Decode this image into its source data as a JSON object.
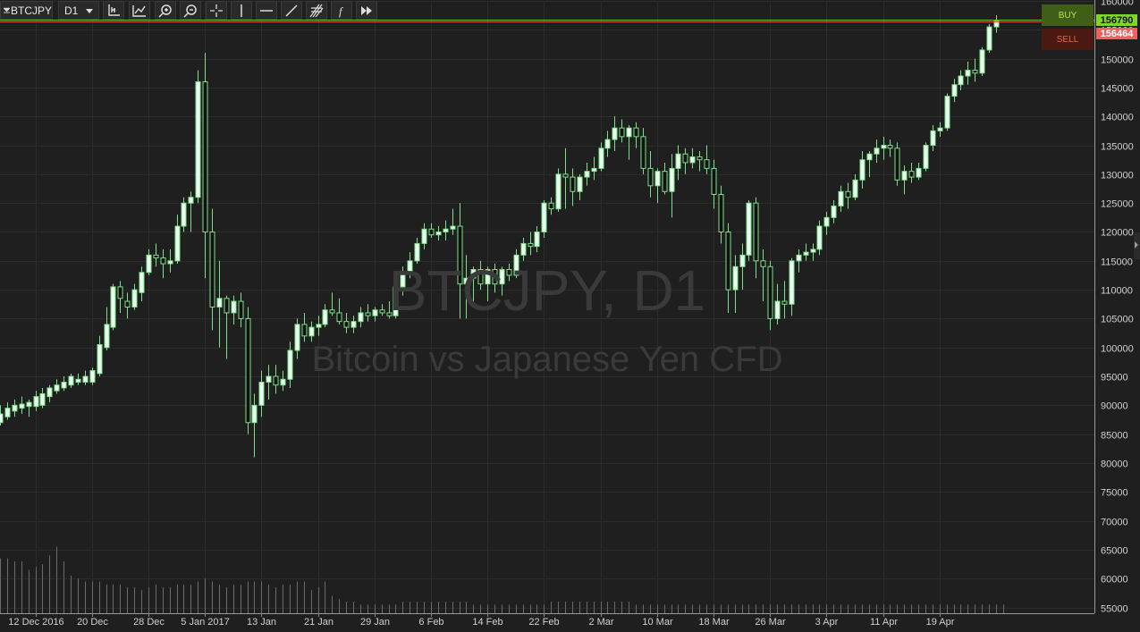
{
  "toolbar": {
    "symbol": "BTCJPY",
    "timeframe": "D1",
    "tools": [
      "crosshair-cursor-icon",
      "auto-scale-icon",
      "zoom-in-icon",
      "zoom-out-icon",
      "crosshair-icon",
      "vertical-line-icon",
      "horizontal-line-icon",
      "trend-line-icon",
      "fibonacci-icon",
      "indicators-icon",
      "fast-forward-icon"
    ]
  },
  "watermark": {
    "title": "BTCJPY, D1",
    "subtitle": "Bitcoin vs Japanese Yen CFD"
  },
  "trade": {
    "buy_label": "BUY",
    "sell_label": "SELL",
    "ask": "156790",
    "bid": "156464"
  },
  "colors": {
    "background": "#1f1f1f",
    "grid": "#2c2c2c",
    "bull_fill": "#e8fff0",
    "candle_outline": "#7ee08a",
    "bear_fill": "#111111",
    "volume": "#6a6a6a",
    "ask_line": "#6ec42a",
    "bid_line": "#e05a4a"
  },
  "chart_data": {
    "type": "candlestick",
    "ylim": [
      54000,
      160000
    ],
    "yticks": [
      55000,
      60000,
      65000,
      70000,
      75000,
      80000,
      85000,
      90000,
      95000,
      100000,
      105000,
      110000,
      115000,
      120000,
      125000,
      130000,
      135000,
      140000,
      145000,
      150000,
      155000,
      160000
    ],
    "xtick_labels": [
      "12 Dec 2016",
      "20 Dec",
      "28 Dec",
      "5 Jan 2017",
      "13 Jan",
      "21 Jan",
      "29 Jan",
      "6 Feb",
      "14 Feb",
      "22 Feb",
      "2 Mar",
      "10 Mar",
      "18 Mar",
      "26 Mar",
      "3 Apr",
      "11 Apr",
      "19 Apr"
    ],
    "xtick_index": [
      5,
      13,
      21,
      29,
      37,
      45,
      53,
      61,
      69,
      77,
      85,
      93,
      101,
      109,
      117,
      125,
      133
    ],
    "grid": true,
    "series": [
      {
        "o": 87000,
        "h": 90000,
        "l": 86500,
        "c": 88500
      },
      {
        "o": 88000,
        "h": 90500,
        "l": 87500,
        "c": 89500
      },
      {
        "o": 89000,
        "h": 91000,
        "l": 88000,
        "c": 90000
      },
      {
        "o": 89500,
        "h": 91500,
        "l": 88500,
        "c": 90200
      },
      {
        "o": 89800,
        "h": 91000,
        "l": 88000,
        "c": 90500
      },
      {
        "o": 89800,
        "h": 92500,
        "l": 89000,
        "c": 91500
      },
      {
        "o": 90000,
        "h": 93000,
        "l": 89500,
        "c": 92000
      },
      {
        "o": 91500,
        "h": 93500,
        "l": 90500,
        "c": 93000
      },
      {
        "o": 92500,
        "h": 94500,
        "l": 92000,
        "c": 93500
      },
      {
        "o": 93000,
        "h": 95000,
        "l": 92500,
        "c": 94000
      },
      {
        "o": 93500,
        "h": 95500,
        "l": 93000,
        "c": 95000
      },
      {
        "o": 94000,
        "h": 95500,
        "l": 93500,
        "c": 94500
      },
      {
        "o": 94000,
        "h": 96000,
        "l": 93500,
        "c": 95000
      },
      {
        "o": 94000,
        "h": 96500,
        "l": 93500,
        "c": 96000
      },
      {
        "o": 95500,
        "h": 102000,
        "l": 95000,
        "c": 100500
      },
      {
        "o": 100000,
        "h": 107000,
        "l": 99500,
        "c": 104000
      },
      {
        "o": 103500,
        "h": 111000,
        "l": 103000,
        "c": 110500
      },
      {
        "o": 110500,
        "h": 111500,
        "l": 106000,
        "c": 108500
      },
      {
        "o": 108000,
        "h": 109500,
        "l": 105000,
        "c": 107000
      },
      {
        "o": 107000,
        "h": 111000,
        "l": 106500,
        "c": 110000
      },
      {
        "o": 109500,
        "h": 114000,
        "l": 108000,
        "c": 113000
      },
      {
        "o": 113000,
        "h": 117000,
        "l": 112500,
        "c": 116000
      },
      {
        "o": 116000,
        "h": 118000,
        "l": 114000,
        "c": 115500
      },
      {
        "o": 115500,
        "h": 117000,
        "l": 112000,
        "c": 114500
      },
      {
        "o": 114500,
        "h": 117000,
        "l": 113000,
        "c": 115000
      },
      {
        "o": 115000,
        "h": 123000,
        "l": 114500,
        "c": 121000
      },
      {
        "o": 121000,
        "h": 126000,
        "l": 120000,
        "c": 125000
      },
      {
        "o": 125000,
        "h": 127000,
        "l": 120000,
        "c": 126000
      },
      {
        "o": 126000,
        "h": 148000,
        "l": 125000,
        "c": 146000
      },
      {
        "o": 146000,
        "h": 151000,
        "l": 112000,
        "c": 120000
      },
      {
        "o": 120000,
        "h": 124000,
        "l": 103000,
        "c": 107000
      },
      {
        "o": 107000,
        "h": 115000,
        "l": 100000,
        "c": 108500
      },
      {
        "o": 108500,
        "h": 109000,
        "l": 98000,
        "c": 106000
      },
      {
        "o": 106000,
        "h": 109000,
        "l": 104000,
        "c": 108000
      },
      {
        "o": 108000,
        "h": 109500,
        "l": 103500,
        "c": 105000
      },
      {
        "o": 105000,
        "h": 107000,
        "l": 85000,
        "c": 87000
      },
      {
        "o": 87000,
        "h": 92000,
        "l": 81000,
        "c": 90000
      },
      {
        "o": 90000,
        "h": 96000,
        "l": 88000,
        "c": 94000
      },
      {
        "o": 94000,
        "h": 97000,
        "l": 91000,
        "c": 95000
      },
      {
        "o": 95000,
        "h": 97000,
        "l": 92000,
        "c": 93500
      },
      {
        "o": 93500,
        "h": 96000,
        "l": 92500,
        "c": 94500
      },
      {
        "o": 94500,
        "h": 101000,
        "l": 93000,
        "c": 99500
      },
      {
        "o": 99500,
        "h": 105000,
        "l": 98000,
        "c": 104000
      },
      {
        "o": 104000,
        "h": 106000,
        "l": 101000,
        "c": 102000
      },
      {
        "o": 102000,
        "h": 104500,
        "l": 101000,
        "c": 103500
      },
      {
        "o": 103500,
        "h": 105500,
        "l": 102000,
        "c": 104000
      },
      {
        "o": 104000,
        "h": 107500,
        "l": 103500,
        "c": 106500
      },
      {
        "o": 106500,
        "h": 109500,
        "l": 105500,
        "c": 106000
      },
      {
        "o": 106000,
        "h": 108500,
        "l": 104000,
        "c": 104500
      },
      {
        "o": 104500,
        "h": 106000,
        "l": 102500,
        "c": 103500
      },
      {
        "o": 103500,
        "h": 105500,
        "l": 102500,
        "c": 104500
      },
      {
        "o": 104500,
        "h": 107000,
        "l": 103500,
        "c": 106000
      },
      {
        "o": 106000,
        "h": 107500,
        "l": 104500,
        "c": 105500
      },
      {
        "o": 105500,
        "h": 107000,
        "l": 104500,
        "c": 106500
      },
      {
        "o": 106500,
        "h": 107500,
        "l": 105500,
        "c": 106000
      },
      {
        "o": 106000,
        "h": 108000,
        "l": 105000,
        "c": 105500
      },
      {
        "o": 105500,
        "h": 111000,
        "l": 105000,
        "c": 110500
      },
      {
        "o": 110500,
        "h": 114000,
        "l": 109000,
        "c": 113000
      },
      {
        "o": 113000,
        "h": 116500,
        "l": 112000,
        "c": 115000
      },
      {
        "o": 115000,
        "h": 119000,
        "l": 114500,
        "c": 118000
      },
      {
        "o": 118000,
        "h": 121500,
        "l": 117000,
        "c": 120500
      },
      {
        "o": 120500,
        "h": 121500,
        "l": 119000,
        "c": 119500
      },
      {
        "o": 119500,
        "h": 121000,
        "l": 118500,
        "c": 120000
      },
      {
        "o": 120000,
        "h": 122000,
        "l": 118500,
        "c": 120500
      },
      {
        "o": 120500,
        "h": 124000,
        "l": 119500,
        "c": 121000
      },
      {
        "o": 121000,
        "h": 125000,
        "l": 105000,
        "c": 111000
      },
      {
        "o": 111000,
        "h": 116000,
        "l": 105000,
        "c": 112000
      },
      {
        "o": 112000,
        "h": 114000,
        "l": 108000,
        "c": 113500
      },
      {
        "o": 113500,
        "h": 115000,
        "l": 110000,
        "c": 111000
      },
      {
        "o": 111000,
        "h": 114000,
        "l": 108000,
        "c": 113500
      },
      {
        "o": 113500,
        "h": 114500,
        "l": 109500,
        "c": 111000
      },
      {
        "o": 111000,
        "h": 114000,
        "l": 109000,
        "c": 113500
      },
      {
        "o": 113500,
        "h": 114500,
        "l": 111500,
        "c": 112500
      },
      {
        "o": 112500,
        "h": 117000,
        "l": 112000,
        "c": 116000
      },
      {
        "o": 116000,
        "h": 119000,
        "l": 115000,
        "c": 118000
      },
      {
        "o": 118000,
        "h": 120000,
        "l": 116000,
        "c": 117500
      },
      {
        "o": 117500,
        "h": 121000,
        "l": 116500,
        "c": 120000
      },
      {
        "o": 120000,
        "h": 125500,
        "l": 119000,
        "c": 125000
      },
      {
        "o": 125000,
        "h": 126000,
        "l": 123000,
        "c": 124000
      },
      {
        "o": 124000,
        "h": 131000,
        "l": 123500,
        "c": 130000
      },
      {
        "o": 130000,
        "h": 134500,
        "l": 124000,
        "c": 129500
      },
      {
        "o": 129500,
        "h": 131000,
        "l": 124500,
        "c": 127000
      },
      {
        "o": 127000,
        "h": 130000,
        "l": 125500,
        "c": 129500
      },
      {
        "o": 129500,
        "h": 132000,
        "l": 128000,
        "c": 130500
      },
      {
        "o": 130500,
        "h": 133000,
        "l": 129000,
        "c": 131000
      },
      {
        "o": 131000,
        "h": 135500,
        "l": 130500,
        "c": 134500
      },
      {
        "o": 134500,
        "h": 137500,
        "l": 133000,
        "c": 136000
      },
      {
        "o": 136000,
        "h": 140000,
        "l": 134000,
        "c": 138000
      },
      {
        "o": 138000,
        "h": 139500,
        "l": 135500,
        "c": 136500
      },
      {
        "o": 136500,
        "h": 138500,
        "l": 132500,
        "c": 138000
      },
      {
        "o": 138000,
        "h": 139000,
        "l": 134500,
        "c": 136500
      },
      {
        "o": 136500,
        "h": 138000,
        "l": 130000,
        "c": 131000
      },
      {
        "o": 131000,
        "h": 134000,
        "l": 126000,
        "c": 128000
      },
      {
        "o": 128000,
        "h": 131000,
        "l": 125000,
        "c": 130500
      },
      {
        "o": 130500,
        "h": 132000,
        "l": 126500,
        "c": 127000
      },
      {
        "o": 127000,
        "h": 133500,
        "l": 122500,
        "c": 131000
      },
      {
        "o": 131000,
        "h": 135000,
        "l": 129000,
        "c": 133500
      },
      {
        "o": 133500,
        "h": 134500,
        "l": 130000,
        "c": 132000
      },
      {
        "o": 132000,
        "h": 134500,
        "l": 131000,
        "c": 133000
      },
      {
        "o": 133000,
        "h": 134000,
        "l": 130500,
        "c": 132500
      },
      {
        "o": 132500,
        "h": 135000,
        "l": 130000,
        "c": 131000
      },
      {
        "o": 131000,
        "h": 132500,
        "l": 124000,
        "c": 126500
      },
      {
        "o": 126500,
        "h": 128000,
        "l": 118000,
        "c": 120000
      },
      {
        "o": 120000,
        "h": 121500,
        "l": 106000,
        "c": 110000
      },
      {
        "o": 110000,
        "h": 116000,
        "l": 106000,
        "c": 114000
      },
      {
        "o": 114000,
        "h": 118000,
        "l": 110000,
        "c": 116000
      },
      {
        "o": 116000,
        "h": 125500,
        "l": 115000,
        "c": 125000
      },
      {
        "o": 125000,
        "h": 126000,
        "l": 112000,
        "c": 115000
      },
      {
        "o": 115000,
        "h": 117000,
        "l": 108000,
        "c": 114000
      },
      {
        "o": 114000,
        "h": 115000,
        "l": 103000,
        "c": 105000
      },
      {
        "o": 105000,
        "h": 111000,
        "l": 104000,
        "c": 108000
      },
      {
        "o": 108000,
        "h": 111500,
        "l": 105000,
        "c": 107500
      },
      {
        "o": 107500,
        "h": 115500,
        "l": 105500,
        "c": 115000
      },
      {
        "o": 115000,
        "h": 117000,
        "l": 113000,
        "c": 116000
      },
      {
        "o": 116000,
        "h": 118000,
        "l": 115000,
        "c": 116500
      },
      {
        "o": 116500,
        "h": 118000,
        "l": 115000,
        "c": 117000
      },
      {
        "o": 117000,
        "h": 122000,
        "l": 116000,
        "c": 121000
      },
      {
        "o": 121000,
        "h": 123500,
        "l": 119500,
        "c": 122500
      },
      {
        "o": 122500,
        "h": 125500,
        "l": 121500,
        "c": 124500
      },
      {
        "o": 124500,
        "h": 128000,
        "l": 123500,
        "c": 127000
      },
      {
        "o": 127000,
        "h": 128500,
        "l": 124000,
        "c": 126000
      },
      {
        "o": 126000,
        "h": 130000,
        "l": 125500,
        "c": 129000
      },
      {
        "o": 129000,
        "h": 134000,
        "l": 127500,
        "c": 132500
      },
      {
        "o": 132500,
        "h": 134000,
        "l": 129500,
        "c": 133500
      },
      {
        "o": 133500,
        "h": 136000,
        "l": 132000,
        "c": 134500
      },
      {
        "o": 134500,
        "h": 136500,
        "l": 132500,
        "c": 135000
      },
      {
        "o": 135000,
        "h": 136000,
        "l": 133000,
        "c": 134500
      },
      {
        "o": 134500,
        "h": 135500,
        "l": 128000,
        "c": 129000
      },
      {
        "o": 129000,
        "h": 131500,
        "l": 126500,
        "c": 130500
      },
      {
        "o": 130500,
        "h": 132000,
        "l": 128500,
        "c": 129500
      },
      {
        "o": 129500,
        "h": 132000,
        "l": 129000,
        "c": 131000
      },
      {
        "o": 131000,
        "h": 135500,
        "l": 130500,
        "c": 135000
      },
      {
        "o": 135000,
        "h": 138500,
        "l": 134000,
        "c": 137500
      },
      {
        "o": 137500,
        "h": 139000,
        "l": 136500,
        "c": 138000
      },
      {
        "o": 138000,
        "h": 144000,
        "l": 137500,
        "c": 143500
      },
      {
        "o": 143500,
        "h": 146500,
        "l": 142500,
        "c": 145500
      },
      {
        "o": 145500,
        "h": 148000,
        "l": 144500,
        "c": 147000
      },
      {
        "o": 147000,
        "h": 149500,
        "l": 145500,
        "c": 148000
      },
      {
        "o": 148000,
        "h": 150000,
        "l": 146000,
        "c": 147500
      },
      {
        "o": 147500,
        "h": 152000,
        "l": 147000,
        "c": 151500
      },
      {
        "o": 151500,
        "h": 156000,
        "l": 151000,
        "c": 155500
      },
      {
        "o": 155500,
        "h": 157500,
        "l": 154500,
        "c": 156500
      }
    ],
    "volume": [
      9500,
      9500,
      9000,
      9000,
      7500,
      8000,
      8500,
      10000,
      11500,
      9000,
      6500,
      6000,
      5500,
      5500,
      5500,
      5000,
      5000,
      5000,
      4500,
      4500,
      4000,
      4500,
      5000,
      4500,
      4500,
      5000,
      5000,
      5000,
      5500,
      6000,
      5500,
      5000,
      4500,
      5000,
      5000,
      5500,
      5500,
      5500,
      5000,
      4500,
      5000,
      5000,
      5500,
      5500,
      4000,
      4500,
      5500,
      3000,
      2500,
      2000,
      2000,
      1500,
      1500,
      1500,
      1500,
      1500,
      1500,
      2000,
      2000,
      2000,
      2000,
      2000,
      2000,
      2000,
      2000,
      2000,
      2000,
      1500,
      1500,
      1500,
      1500,
      1500,
      1500,
      1500,
      1500,
      1500,
      1500,
      1500,
      2000,
      2000,
      2000,
      2000,
      2000,
      2000,
      2000,
      2000,
      2000,
      2000,
      2000,
      2000,
      1500,
      1500,
      1500,
      1500,
      1500,
      1500,
      1500,
      1500,
      1500,
      1500,
      1500,
      1500,
      1500,
      1500,
      1500,
      1500,
      1500,
      1500,
      1500,
      1500,
      1500,
      1500,
      1500,
      1500,
      1500,
      1500,
      1500,
      1500,
      1500,
      1500,
      1500,
      1500,
      1500,
      1500,
      1500,
      1500,
      1500,
      1500,
      1500,
      1500,
      1500,
      1500,
      1500,
      1500,
      1500,
      1500,
      1500,
      1500,
      1500,
      1500,
      1500,
      1500,
      1500
    ],
    "ask": 156790,
    "bid": 156464
  }
}
